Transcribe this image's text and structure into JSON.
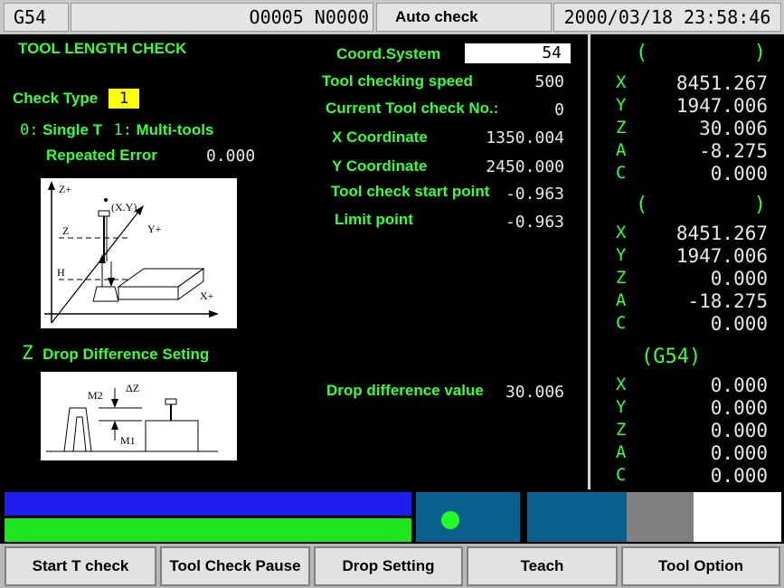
{
  "header": {
    "coord_mode": "G54",
    "program": "O0005 N0000",
    "mode": "Auto check",
    "datetime": "2000/03/18 23:58:46"
  },
  "main": {
    "title": "TOOL LENGTH CHECK",
    "check_type_label": "Check Type",
    "check_type_value": "1",
    "type_options": "0: Single T  1: Multi-tools",
    "type_opt0": "0:",
    "type_opt0_label": "Single T",
    "type_opt1": "1:",
    "type_opt1_label": "Multi-tools",
    "repeated_error_label": "Repeated Error",
    "repeated_error_value": "0.000",
    "drop_section_title": "Drop Difference Seting",
    "drop_section_prefix": "Z",
    "params": {
      "coord_system_label": "Coord.System",
      "coord_system_value": "54",
      "speed_label": "Tool checking speed",
      "speed_value": "500",
      "current_no_label": "Current Tool check No.:",
      "current_no_value": "0",
      "x_coord_label": "X Coordinate",
      "x_coord_value": "1350.004",
      "y_coord_label": "Y Coordinate",
      "y_coord_value": "2450.000",
      "start_point_label": "Tool check start point",
      "start_point_value": "-0.963",
      "limit_point_label": "Limit point",
      "limit_point_value": "-0.963",
      "drop_diff_label": "Drop difference value",
      "drop_diff_value": "30.006"
    },
    "diagram1": {
      "zplus": "Z+",
      "xy": "(X.Y)",
      "yplus": "Y+",
      "z": "Z",
      "h": "H",
      "xplus": "X+"
    },
    "diagram2": {
      "m2": "M2",
      "dz": "ΔZ",
      "m1": "M1"
    }
  },
  "right_panel": {
    "groups": [
      {
        "header": "",
        "rows": [
          {
            "axis": "X",
            "value": "8451.267"
          },
          {
            "axis": "Y",
            "value": "1947.006"
          },
          {
            "axis": "Z",
            "value": "30.006"
          },
          {
            "axis": "A",
            "value": "-8.275"
          },
          {
            "axis": "C",
            "value": "0.000"
          }
        ]
      },
      {
        "header": "",
        "rows": [
          {
            "axis": "X",
            "value": "8451.267"
          },
          {
            "axis": "Y",
            "value": "1947.006"
          },
          {
            "axis": "Z",
            "value": "0.000"
          },
          {
            "axis": "A",
            "value": "-18.275"
          },
          {
            "axis": "C",
            "value": "0.000"
          }
        ]
      },
      {
        "header": "(G54)",
        "rows": [
          {
            "axis": "X",
            "value": "0.000"
          },
          {
            "axis": "Y",
            "value": "0.000"
          },
          {
            "axis": "Z",
            "value": "0.000"
          },
          {
            "axis": "A",
            "value": "0.000"
          },
          {
            "axis": "C",
            "value": "0.000"
          }
        ]
      }
    ]
  },
  "status_bars": {
    "colors": {
      "blue": "#1e1ef0",
      "green": "#1ee61e",
      "teal": "#0a5f8c",
      "led": "#22ff22",
      "gray": "#808080",
      "white": "#ffffff"
    }
  },
  "softkeys": [
    "Start T check",
    "Tool Check Pause",
    "Drop Setting",
    "Teach",
    "Tool Option"
  ]
}
